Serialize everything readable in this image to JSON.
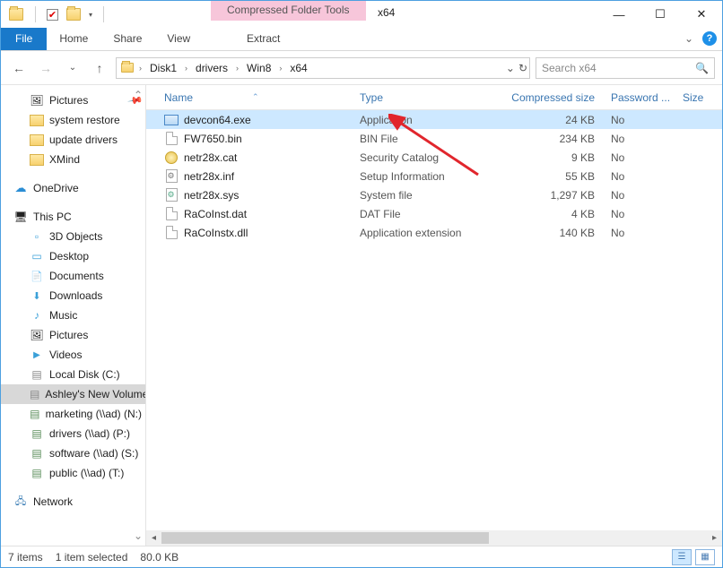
{
  "window": {
    "context_tools_label": "Compressed Folder Tools",
    "title": "x64",
    "minimize": "—",
    "maximize": "☐",
    "close": "✕"
  },
  "ribbon": {
    "file": "File",
    "tabs": [
      "Home",
      "Share",
      "View"
    ],
    "context_tab": "Extract",
    "expand_caret": "⌄"
  },
  "nav": {
    "back": "←",
    "forward": "→",
    "recent_caret": "⌄",
    "up": "↑"
  },
  "breadcrumbs": {
    "items": [
      "Disk1",
      "drivers",
      "Win8",
      "x64"
    ],
    "refresh": "↻",
    "dropdown": "⌄"
  },
  "search": {
    "placeholder": "Search x64",
    "icon": "🔍"
  },
  "tree": {
    "pictures_quick": "Pictures",
    "system_restore": "system restore",
    "update_drivers": "update drivers",
    "xmind": "XMind",
    "onedrive": "OneDrive",
    "thispc": "This PC",
    "objects3d": "3D Objects",
    "desktop": "Desktop",
    "documents": "Documents",
    "downloads": "Downloads",
    "music": "Music",
    "pictures": "Pictures",
    "videos": "Videos",
    "localdisk": "Local Disk (C:)",
    "ashley": "Ashley's New Volume",
    "marketing": "marketing (\\\\ad) (N:)",
    "drivers_net": "drivers (\\\\ad) (P:)",
    "software": "software (\\\\ad) (S:)",
    "public_net": "public (\\\\ad) (T:)",
    "network": "Network"
  },
  "columns": {
    "name": "Name",
    "type": "Type",
    "compressed": "Compressed size",
    "password": "Password ...",
    "size": "Size"
  },
  "files": [
    {
      "name": "devcon64.exe",
      "type": "Application",
      "size": "24 KB",
      "pw": "No",
      "icon": "exe",
      "selected": true
    },
    {
      "name": "FW7650.bin",
      "type": "BIN File",
      "size": "234 KB",
      "pw": "No",
      "icon": "page"
    },
    {
      "name": "netr28x.cat",
      "type": "Security Catalog",
      "size": "9 KB",
      "pw": "No",
      "icon": "cat"
    },
    {
      "name": "netr28x.inf",
      "type": "Setup Information",
      "size": "55 KB",
      "pw": "No",
      "icon": "inf"
    },
    {
      "name": "netr28x.sys",
      "type": "System file",
      "size": "1,297 KB",
      "pw": "No",
      "icon": "sys"
    },
    {
      "name": "RaCoInst.dat",
      "type": "DAT File",
      "size": "4 KB",
      "pw": "No",
      "icon": "page"
    },
    {
      "name": "RaCoInstx.dll",
      "type": "Application extension",
      "size": "140 KB",
      "pw": "No",
      "icon": "page"
    }
  ],
  "status": {
    "count": "7 items",
    "selection": "1 item selected",
    "size": "80.0 KB"
  }
}
